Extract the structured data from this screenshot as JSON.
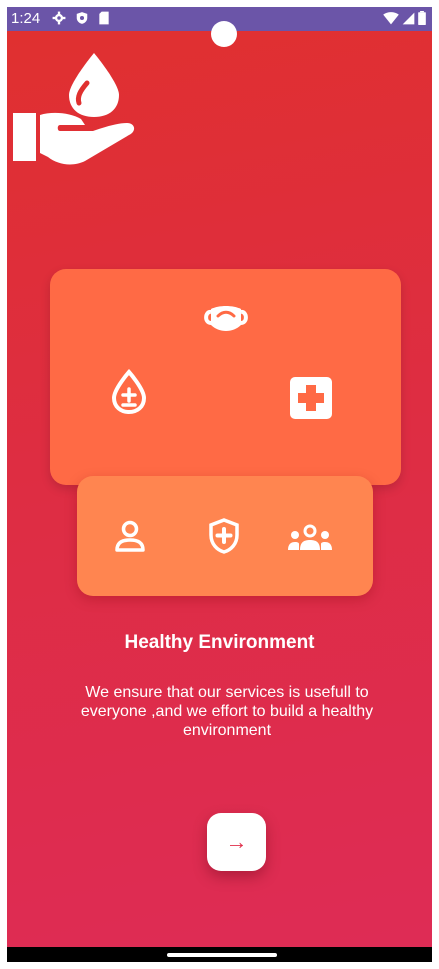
{
  "status_bar": {
    "time": "1:24",
    "left_icons": [
      "settings-icon",
      "shield-icon",
      "sd-card-icon"
    ],
    "right_icons": [
      "wifi-icon",
      "signal-icon",
      "battery-icon"
    ],
    "bar_color": "#6b55a8"
  },
  "logo": {
    "icon": "blood-drop-hand-icon"
  },
  "features_card": {
    "icons": [
      "face-mask-icon",
      "blood-drop-plus-minus-icon",
      "first-aid-icon"
    ],
    "color": "#ff6a45"
  },
  "people_card": {
    "icons": [
      "person-icon",
      "shield-cross-icon",
      "group-icon"
    ],
    "color": "#ff8550"
  },
  "onboarding": {
    "title": "Healthy Environment",
    "description": "We ensure that our services is usefull to everyone ,and we effort to build a healthy environment"
  },
  "next_button": {
    "label": "→",
    "icon": "arrow-right-icon"
  },
  "colors": {
    "background_top": "#e0302f",
    "background_bottom": "#de2c56",
    "accent": "#e0304b"
  }
}
